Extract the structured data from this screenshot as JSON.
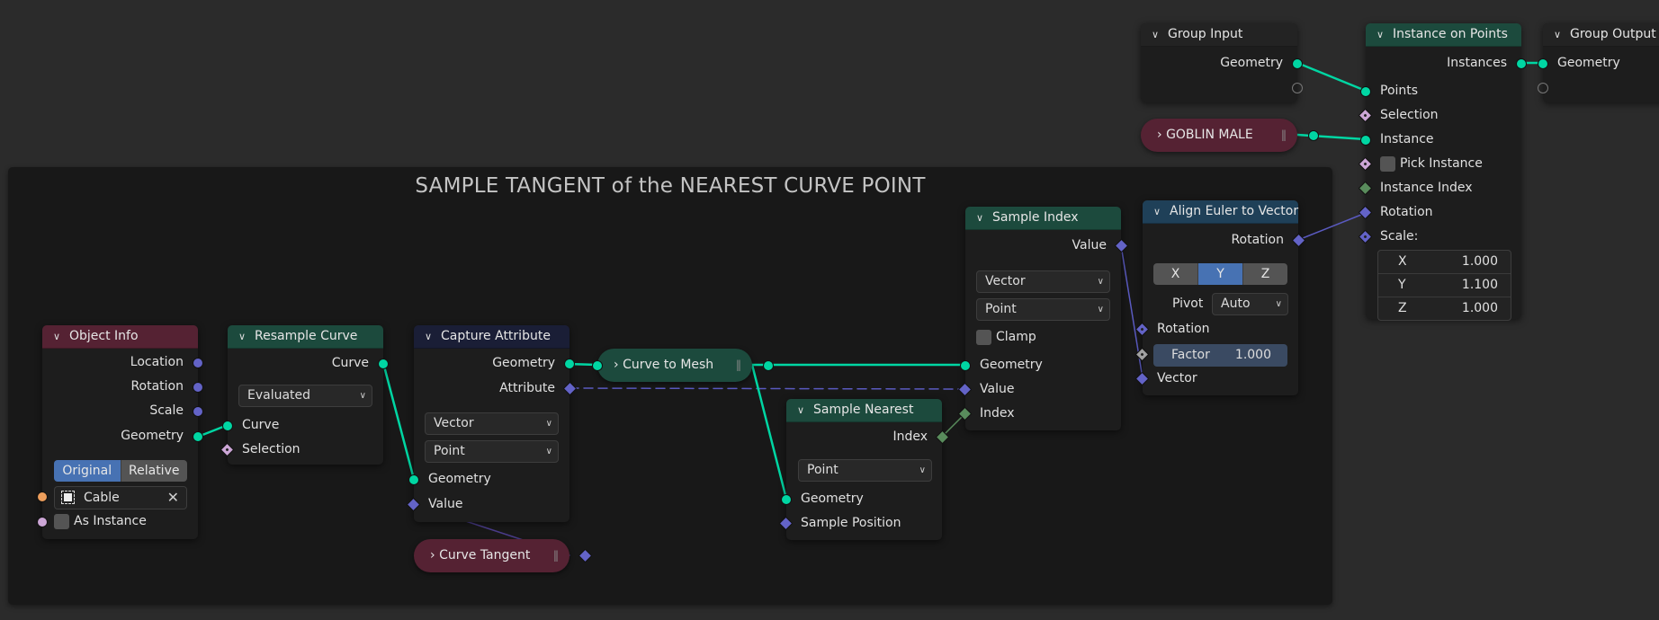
{
  "frame": {
    "title": "SAMPLE TANGENT of the NEAREST CURVE POINT"
  },
  "colors": {
    "geometry_socket": "#00d6a3",
    "vector_socket": "#6363c7",
    "boolean_socket": "#cca6d6",
    "integer_socket": "#598c5c",
    "object_socket": "#ed9e5c",
    "input_node_header": "#552233",
    "geometry_node_header": "#1c4a3d",
    "attribute_node_header": "#1a1e36",
    "vector_node_header": "#1f4058",
    "active_toggle": "#4772b3"
  },
  "nodes": {
    "object_info": {
      "title": "Object Info",
      "outputs": [
        "Location",
        "Rotation",
        "Scale",
        "Geometry"
      ],
      "transform_space": {
        "options": [
          "Original",
          "Relative"
        ],
        "selected": "Original"
      },
      "object": "Cable",
      "as_instance_label": "As Instance",
      "as_instance": false
    },
    "resample_curve": {
      "title": "Resample Curve",
      "output": "Curve",
      "mode": "Evaluated",
      "inputs": [
        "Curve",
        "Selection"
      ]
    },
    "capture_attribute": {
      "title": "Capture Attribute",
      "outputs": [
        "Geometry",
        "Attribute"
      ],
      "data_type": "Vector",
      "domain": "Point",
      "inputs": [
        "Geometry",
        "Value"
      ]
    },
    "curve_tangent": {
      "title": "Curve Tangent"
    },
    "curve_to_mesh": {
      "title": "Curve to Mesh"
    },
    "sample_nearest": {
      "title": "Sample Nearest",
      "output": "Index",
      "domain": "Point",
      "inputs": [
        "Geometry",
        "Sample Position"
      ]
    },
    "sample_index": {
      "title": "Sample Index",
      "output": "Value",
      "data_type": "Vector",
      "domain": "Point",
      "clamp_label": "Clamp",
      "clamp": false,
      "inputs": [
        "Geometry",
        "Value",
        "Index"
      ]
    },
    "align_euler": {
      "title": "Align Euler to Vector",
      "output": "Rotation",
      "axis": {
        "options": [
          "X",
          "Y",
          "Z"
        ],
        "selected": "Y"
      },
      "pivot_label": "Pivot",
      "pivot": "Auto",
      "inputs": [
        "Rotation",
        "Vector"
      ],
      "factor_label": "Factor",
      "factor": "1.000"
    },
    "group_input": {
      "title": "Group Input",
      "outputs": [
        "Geometry"
      ]
    },
    "goblin_male": {
      "title": "GOBLIN MALE"
    },
    "instance_on_points": {
      "title": "Instance on Points",
      "output": "Instances",
      "inputs": [
        "Points",
        "Selection",
        "Instance",
        "Pick Instance",
        "Instance Index",
        "Rotation",
        "Scale:"
      ],
      "pick_instance": false,
      "scale": [
        {
          "axis": "X",
          "value": "1.000"
        },
        {
          "axis": "Y",
          "value": "1.100"
        },
        {
          "axis": "Z",
          "value": "1.000"
        }
      ]
    },
    "group_output": {
      "title": "Group Output",
      "inputs": [
        "Geometry"
      ]
    }
  },
  "links": [
    {
      "from": "Object Info.Geometry",
      "to": "Resample Curve.Curve"
    },
    {
      "from": "Resample Curve.Curve",
      "to": "Capture Attribute.Geometry"
    },
    {
      "from": "Curve Tangent",
      "to": "Capture Attribute.Value"
    },
    {
      "from": "Capture Attribute.Geometry",
      "to": "Curve to Mesh"
    },
    {
      "from": "Capture Attribute.Attribute",
      "to": "Sample Index.Value"
    },
    {
      "from": "Curve to Mesh",
      "to": "Sample Index.Geometry"
    },
    {
      "from": "Curve to Mesh",
      "to": "Sample Nearest.Geometry"
    },
    {
      "from": "Sample Nearest.Index",
      "to": "Sample Index.Index"
    },
    {
      "from": "Sample Index.Value",
      "to": "Align Euler to Vector.Vector"
    },
    {
      "from": "Align Euler to Vector.Rotation",
      "to": "Instance on Points.Rotation"
    },
    {
      "from": "Group Input.Geometry",
      "to": "Instance on Points.Points"
    },
    {
      "from": "GOBLIN MALE",
      "to": "Instance on Points.Instance"
    },
    {
      "from": "Instance on Points.Instances",
      "to": "Group Output.Geometry"
    }
  ]
}
